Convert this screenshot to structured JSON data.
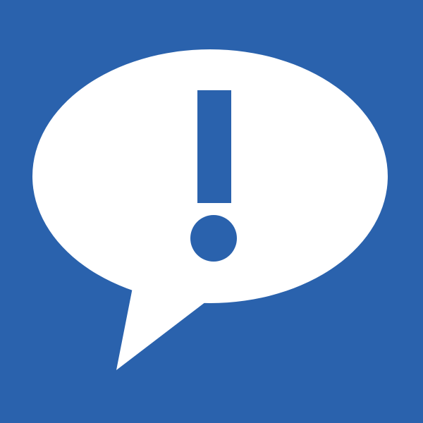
{
  "icon": {
    "name": "speech-bubble-exclamation-icon",
    "background_color": "#2A62AD",
    "bubble_color": "#FFFFFF",
    "mark_color": "#2A62AD"
  }
}
